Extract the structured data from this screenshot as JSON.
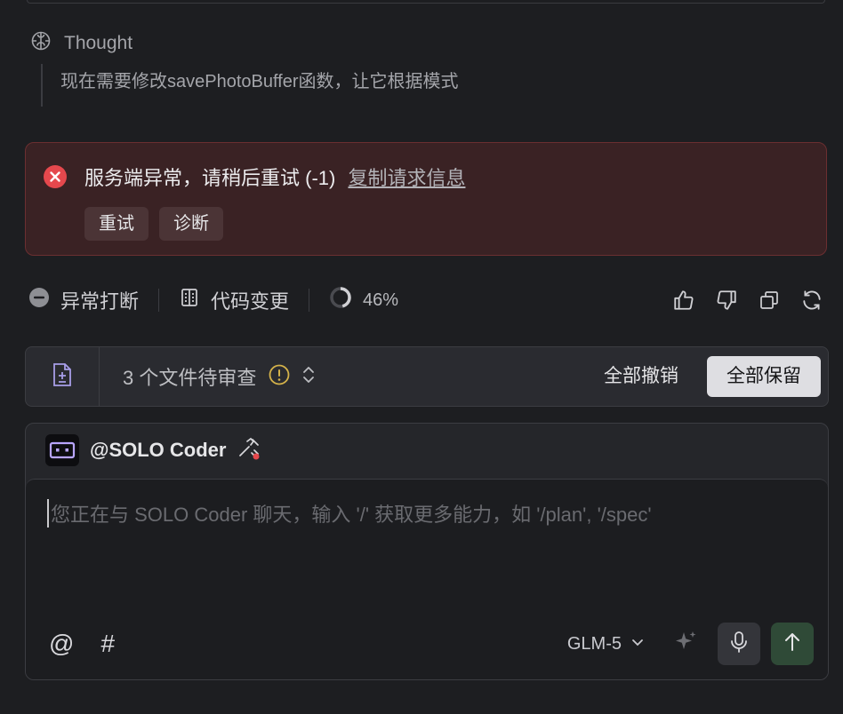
{
  "thought": {
    "label": "Thought",
    "text": "现在需要修改savePhotoBuffer函数，让它根据模式",
    "icon": "brain-icon"
  },
  "error": {
    "message": "服务端异常，请稍后重试 (-1)",
    "link": "复制请求信息",
    "retry_label": "重试",
    "diagnose_label": "诊断",
    "color": "#e5484d"
  },
  "status": {
    "interrupted": "异常打断",
    "code_changes": "代码变更",
    "progress_text": "46%",
    "progress_value": 0.46
  },
  "review": {
    "text": "3 个文件待审查",
    "revert_all": "全部撤销",
    "keep_all": "全部保留",
    "warn_color": "#d4b24a"
  },
  "composer": {
    "agent": "@SOLO Coder",
    "placeholder": "您正在与 SOLO Coder 聊天，输入 '/' 获取更多能力，如 '/plan', '/spec'",
    "at_symbol": "@",
    "hash_symbol": "#",
    "model": "GLM-5",
    "send_color": "#2f4a37"
  }
}
